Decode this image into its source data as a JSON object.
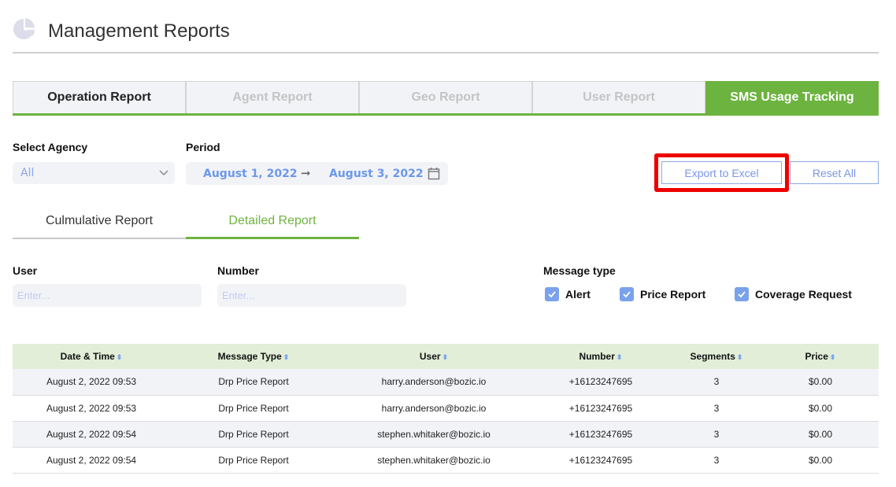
{
  "header": {
    "title": "Management Reports",
    "icon": "pie-chart-icon"
  },
  "report_tabs": [
    {
      "label": "Operation Report",
      "state": "normal"
    },
    {
      "label": "Agent Report",
      "state": "disabled"
    },
    {
      "label": "Geo Report",
      "state": "disabled"
    },
    {
      "label": "User Report",
      "state": "disabled"
    },
    {
      "label": "SMS Usage Tracking",
      "state": "active"
    }
  ],
  "filters": {
    "agency_label": "Select Agency",
    "agency_value": "All",
    "period_label": "Period",
    "period_start": "August 1, 2022",
    "period_arrow": "➞",
    "period_end": "August 3, 2022"
  },
  "actions": {
    "export_label": "Export to Excel",
    "reset_label": "Reset All"
  },
  "sub_tabs": [
    {
      "label": "Culmulative Report",
      "active": false
    },
    {
      "label": "Detailed Report",
      "active": true
    }
  ],
  "search": {
    "user_label": "User",
    "user_placeholder": "Enter...",
    "number_label": "Number",
    "number_placeholder": "Enter...",
    "message_type_label": "Message type",
    "message_types": [
      {
        "label": "Alert",
        "checked": true
      },
      {
        "label": "Price Report",
        "checked": true
      },
      {
        "label": "Coverage Request",
        "checked": true
      }
    ]
  },
  "table": {
    "sort_glyph": "⬍",
    "columns": [
      "Date & Time",
      "Message Type",
      "User",
      "Number",
      "Segments",
      "Price"
    ],
    "rows": [
      [
        "August 2, 2022 09:53",
        "Drp Price Report",
        "harry.anderson@bozic.io",
        "+16123247695",
        "3",
        "$0.00"
      ],
      [
        "August 2, 2022 09:53",
        "Drp Price Report",
        "harry.anderson@bozic.io",
        "+16123247695",
        "3",
        "$0.00"
      ],
      [
        "August 2, 2022 09:54",
        "Drp Price Report",
        "stephen.whitaker@bozic.io",
        "+16123247695",
        "3",
        "$0.00"
      ],
      [
        "August 2, 2022 09:54",
        "Drp Price Report",
        "stephen.whitaker@bozic.io",
        "+16123247695",
        "3",
        "$0.00"
      ]
    ]
  },
  "colors": {
    "accent_green": "#6db33f",
    "accent_blue": "#7aa1ec",
    "highlight_red": "#ee0000"
  }
}
